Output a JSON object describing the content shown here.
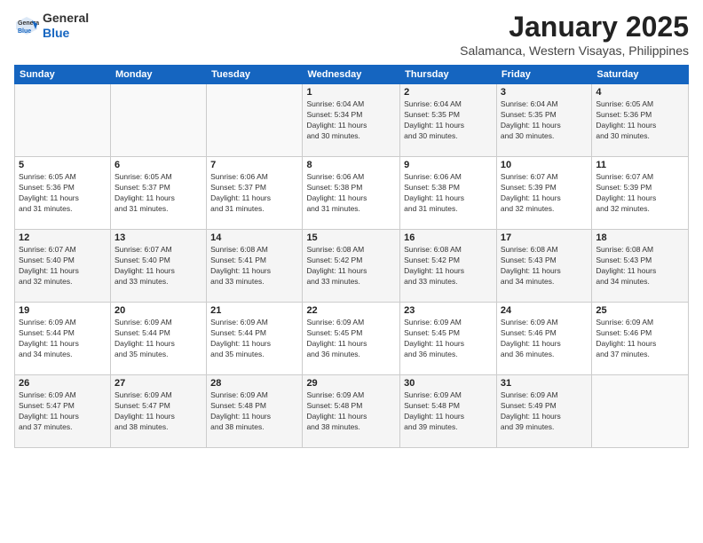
{
  "header": {
    "logo_general": "General",
    "logo_blue": "Blue",
    "month": "January 2025",
    "location": "Salamanca, Western Visayas, Philippines"
  },
  "days_of_week": [
    "Sunday",
    "Monday",
    "Tuesday",
    "Wednesday",
    "Thursday",
    "Friday",
    "Saturday"
  ],
  "weeks": [
    [
      {
        "day": "",
        "info": ""
      },
      {
        "day": "",
        "info": ""
      },
      {
        "day": "",
        "info": ""
      },
      {
        "day": "1",
        "info": "Sunrise: 6:04 AM\nSunset: 5:34 PM\nDaylight: 11 hours\nand 30 minutes."
      },
      {
        "day": "2",
        "info": "Sunrise: 6:04 AM\nSunset: 5:35 PM\nDaylight: 11 hours\nand 30 minutes."
      },
      {
        "day": "3",
        "info": "Sunrise: 6:04 AM\nSunset: 5:35 PM\nDaylight: 11 hours\nand 30 minutes."
      },
      {
        "day": "4",
        "info": "Sunrise: 6:05 AM\nSunset: 5:36 PM\nDaylight: 11 hours\nand 30 minutes."
      }
    ],
    [
      {
        "day": "5",
        "info": "Sunrise: 6:05 AM\nSunset: 5:36 PM\nDaylight: 11 hours\nand 31 minutes."
      },
      {
        "day": "6",
        "info": "Sunrise: 6:05 AM\nSunset: 5:37 PM\nDaylight: 11 hours\nand 31 minutes."
      },
      {
        "day": "7",
        "info": "Sunrise: 6:06 AM\nSunset: 5:37 PM\nDaylight: 11 hours\nand 31 minutes."
      },
      {
        "day": "8",
        "info": "Sunrise: 6:06 AM\nSunset: 5:38 PM\nDaylight: 11 hours\nand 31 minutes."
      },
      {
        "day": "9",
        "info": "Sunrise: 6:06 AM\nSunset: 5:38 PM\nDaylight: 11 hours\nand 31 minutes."
      },
      {
        "day": "10",
        "info": "Sunrise: 6:07 AM\nSunset: 5:39 PM\nDaylight: 11 hours\nand 32 minutes."
      },
      {
        "day": "11",
        "info": "Sunrise: 6:07 AM\nSunset: 5:39 PM\nDaylight: 11 hours\nand 32 minutes."
      }
    ],
    [
      {
        "day": "12",
        "info": "Sunrise: 6:07 AM\nSunset: 5:40 PM\nDaylight: 11 hours\nand 32 minutes."
      },
      {
        "day": "13",
        "info": "Sunrise: 6:07 AM\nSunset: 5:40 PM\nDaylight: 11 hours\nand 33 minutes."
      },
      {
        "day": "14",
        "info": "Sunrise: 6:08 AM\nSunset: 5:41 PM\nDaylight: 11 hours\nand 33 minutes."
      },
      {
        "day": "15",
        "info": "Sunrise: 6:08 AM\nSunset: 5:42 PM\nDaylight: 11 hours\nand 33 minutes."
      },
      {
        "day": "16",
        "info": "Sunrise: 6:08 AM\nSunset: 5:42 PM\nDaylight: 11 hours\nand 33 minutes."
      },
      {
        "day": "17",
        "info": "Sunrise: 6:08 AM\nSunset: 5:43 PM\nDaylight: 11 hours\nand 34 minutes."
      },
      {
        "day": "18",
        "info": "Sunrise: 6:08 AM\nSunset: 5:43 PM\nDaylight: 11 hours\nand 34 minutes."
      }
    ],
    [
      {
        "day": "19",
        "info": "Sunrise: 6:09 AM\nSunset: 5:44 PM\nDaylight: 11 hours\nand 34 minutes."
      },
      {
        "day": "20",
        "info": "Sunrise: 6:09 AM\nSunset: 5:44 PM\nDaylight: 11 hours\nand 35 minutes."
      },
      {
        "day": "21",
        "info": "Sunrise: 6:09 AM\nSunset: 5:44 PM\nDaylight: 11 hours\nand 35 minutes."
      },
      {
        "day": "22",
        "info": "Sunrise: 6:09 AM\nSunset: 5:45 PM\nDaylight: 11 hours\nand 36 minutes."
      },
      {
        "day": "23",
        "info": "Sunrise: 6:09 AM\nSunset: 5:45 PM\nDaylight: 11 hours\nand 36 minutes."
      },
      {
        "day": "24",
        "info": "Sunrise: 6:09 AM\nSunset: 5:46 PM\nDaylight: 11 hours\nand 36 minutes."
      },
      {
        "day": "25",
        "info": "Sunrise: 6:09 AM\nSunset: 5:46 PM\nDaylight: 11 hours\nand 37 minutes."
      }
    ],
    [
      {
        "day": "26",
        "info": "Sunrise: 6:09 AM\nSunset: 5:47 PM\nDaylight: 11 hours\nand 37 minutes."
      },
      {
        "day": "27",
        "info": "Sunrise: 6:09 AM\nSunset: 5:47 PM\nDaylight: 11 hours\nand 38 minutes."
      },
      {
        "day": "28",
        "info": "Sunrise: 6:09 AM\nSunset: 5:48 PM\nDaylight: 11 hours\nand 38 minutes."
      },
      {
        "day": "29",
        "info": "Sunrise: 6:09 AM\nSunset: 5:48 PM\nDaylight: 11 hours\nand 38 minutes."
      },
      {
        "day": "30",
        "info": "Sunrise: 6:09 AM\nSunset: 5:48 PM\nDaylight: 11 hours\nand 39 minutes."
      },
      {
        "day": "31",
        "info": "Sunrise: 6:09 AM\nSunset: 5:49 PM\nDaylight: 11 hours\nand 39 minutes."
      },
      {
        "day": "",
        "info": ""
      }
    ]
  ]
}
